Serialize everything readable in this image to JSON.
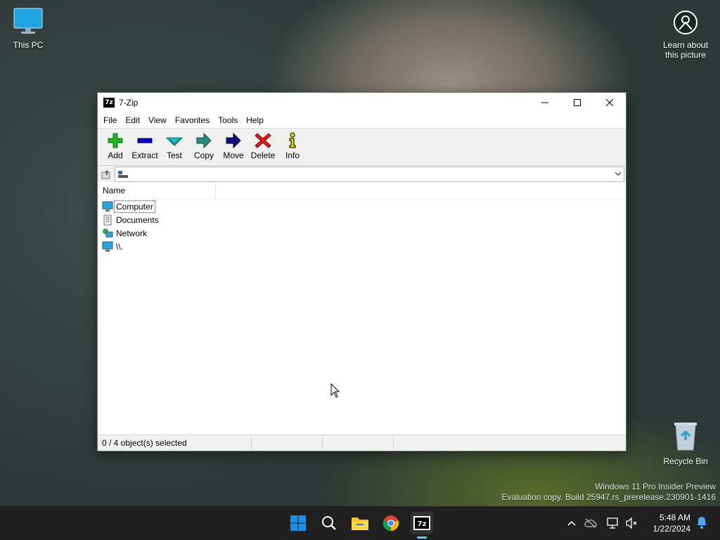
{
  "desktop": {
    "this_pc_label": "This PC",
    "learn_label_1": "Learn about",
    "learn_label_2": "this picture",
    "recycle_label": "Recycle Bin",
    "watermark_line1": "Windows 11 Pro Insider Preview",
    "watermark_line2": "Evaluation copy. Build 25947.rs_prerelease.230901-1416"
  },
  "window": {
    "title": "7-Zip",
    "app_icon_text": "7z",
    "menu": [
      "File",
      "Edit",
      "View",
      "Favorites",
      "Tools",
      "Help"
    ],
    "toolbar": [
      {
        "label": "Add",
        "icon": "plus-icon",
        "color": "#22b422"
      },
      {
        "label": "Extract",
        "icon": "minus-icon",
        "color": "#0000c8"
      },
      {
        "label": "Test",
        "icon": "check-icon",
        "color": "#20c0c0"
      },
      {
        "label": "Copy",
        "icon": "copy-arrow-icon",
        "color": "#2a8a7a"
      },
      {
        "label": "Move",
        "icon": "move-arrow-icon",
        "color": "#10107a"
      },
      {
        "label": "Delete",
        "icon": "delete-x-icon",
        "color": "#e02020"
      },
      {
        "label": "Info",
        "icon": "info-icon",
        "color": "#e8d800"
      }
    ],
    "address_value": "",
    "column_name": "Name",
    "items": [
      {
        "name": "Computer",
        "icon": "computer-icon"
      },
      {
        "name": "Documents",
        "icon": "documents-icon"
      },
      {
        "name": "Network",
        "icon": "network-icon"
      },
      {
        "name": "\\\\.",
        "icon": "device-icon"
      }
    ],
    "status": "0 / 4 object(s) selected"
  },
  "taskbar": {
    "time": "5:48 AM",
    "date": "1/22/2024"
  }
}
